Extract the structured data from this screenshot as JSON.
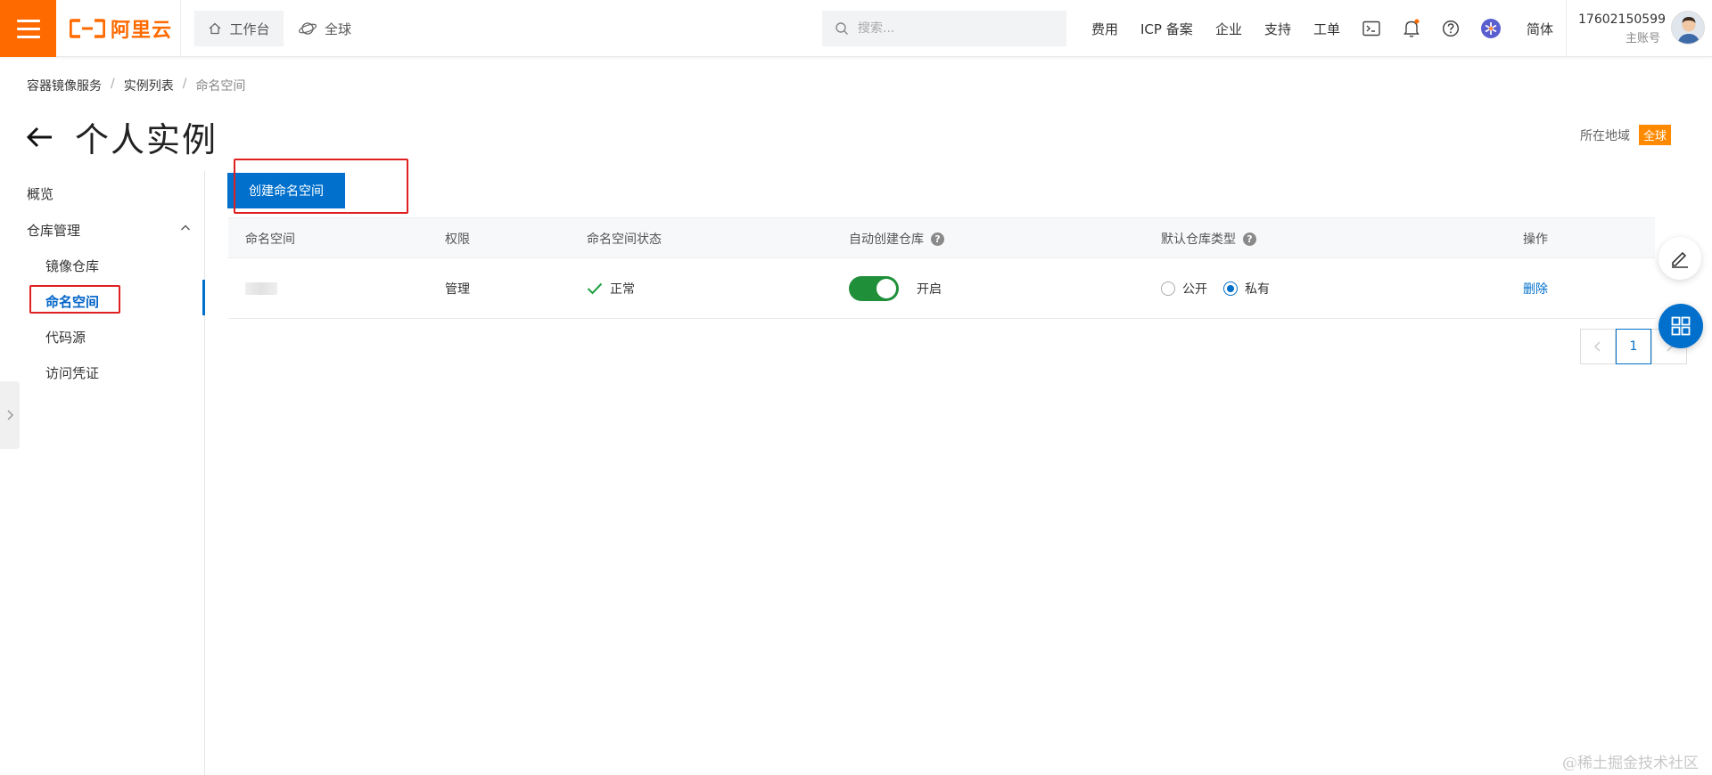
{
  "topbar": {
    "logo_text": "阿里云",
    "workbench": "工作台",
    "global": "全球",
    "search_placeholder": "搜索...",
    "links": [
      "费用",
      "ICP 备案",
      "企业",
      "支持",
      "工单"
    ],
    "language": "简体",
    "account_id": "17602150599",
    "account_role": "主账号",
    "brand_color": "#ff6a00"
  },
  "breadcrumb": [
    "容器镜像服务",
    "实例列表",
    "命名空间"
  ],
  "page": {
    "title": "个人实例",
    "region_label": "所在地域",
    "region_value": "全球"
  },
  "sidebar": {
    "overview": "概览",
    "repo_mgmt": "仓库管理",
    "items": [
      "镜像仓库",
      "命名空间",
      "代码源",
      "访问凭证"
    ],
    "active": "命名空间"
  },
  "main": {
    "create_button": "创建命名空间",
    "columns": [
      "命名空间",
      "权限",
      "命名空间状态",
      "自动创建仓库",
      "默认仓库类型",
      "操作"
    ],
    "rows": [
      {
        "name": "",
        "permission": "管理",
        "status": "正常",
        "auto_create": "开启",
        "auto_create_on": true,
        "repo_type_options": [
          "公开",
          "私有"
        ],
        "repo_type_selected": "私有",
        "action": "删除"
      }
    ],
    "pagination": {
      "current_page": "1"
    },
    "accent_color": "#0070cc"
  },
  "watermark": "@稀土掘金技术社区"
}
